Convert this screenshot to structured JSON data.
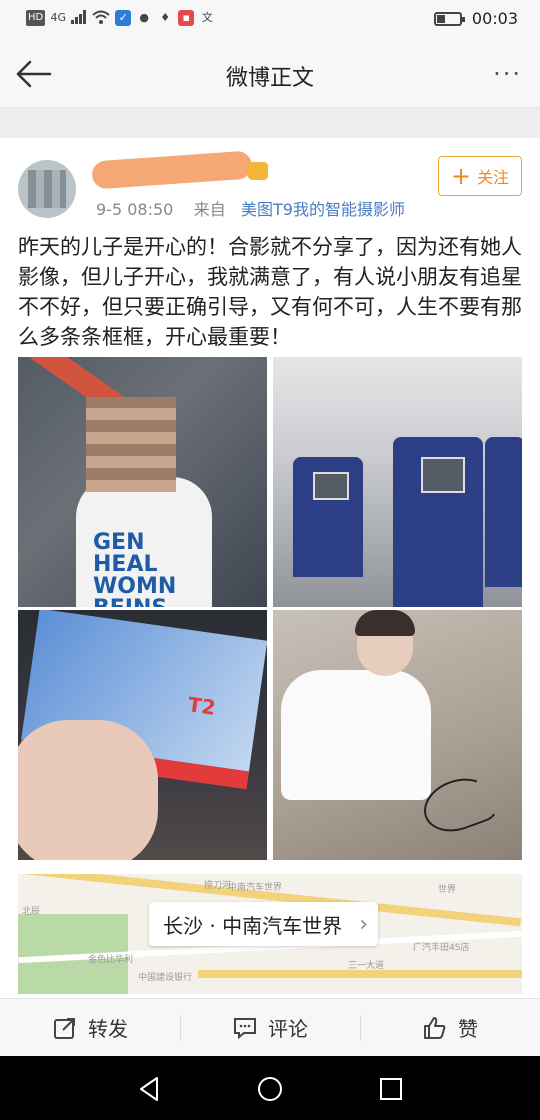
{
  "status_bar": {
    "hd": "HD",
    "network": "4G",
    "time": "00:03",
    "battery_level": 0.35
  },
  "header": {
    "title": "微博正文",
    "more_label": "···"
  },
  "post": {
    "meta_time": "9-5 08:50",
    "meta_from": "来自",
    "meta_source": "美图T9我的智能摄影师",
    "follow_label": "关注",
    "body": "昨天的儿子是开心的！合影就不分享了，因为还有她人影像，但儿子开心，我就满意了，有人说小朋友有追星不不好，但只要正确引导，又有何不可，人生不要有那么多条条框框，开心最重要！",
    "photo1_text_lines": [
      "GEN",
      "HEAL",
      "WOMN",
      "BEINS"
    ],
    "photo3_text": "T2",
    "location": "长沙 · 中南汽车世界",
    "map_labels": [
      "中南汽车世界",
      "世界",
      "广汽丰田4S店",
      "三一大道",
      "中国建设银行",
      "北辰",
      "金色比华利",
      "捞刀河"
    ]
  },
  "actions": {
    "repost": "转发",
    "comment": "评论",
    "like": "赞"
  },
  "icons": {
    "back": "back-arrow-icon",
    "more": "more-dots-icon",
    "follow": "plus-icon",
    "repost": "repost-icon",
    "comment": "comment-icon",
    "like": "thumbs-up-icon",
    "nav_back": "nav-back-icon",
    "nav_home": "nav-home-icon",
    "nav_recent": "nav-recent-icon"
  },
  "colors": {
    "accent": "#f08a1e",
    "link": "#4a7dbf"
  }
}
